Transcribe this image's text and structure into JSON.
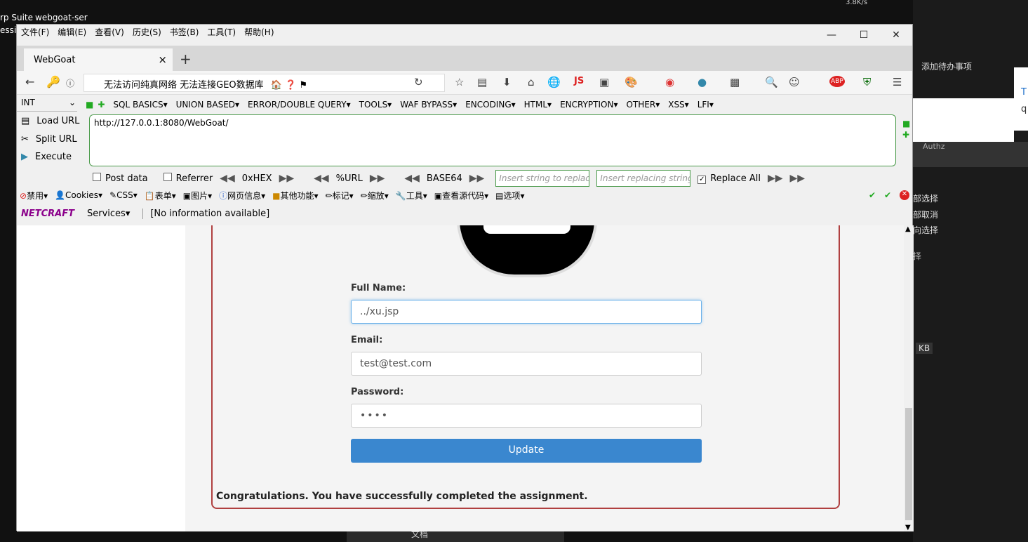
{
  "desktop": {
    "icon1_label": "rp Suite",
    "icon1_sub": "essi",
    "icon2_label": "webgoat-ser",
    "net_speed": "3.8K/s"
  },
  "right_panel": {
    "todo": "添加待办事项",
    "t_char": "T",
    "q_char": "q",
    "authz": "Authz",
    "select_all": "部选择",
    "cancel_all": "部取消",
    "invert": "向选择",
    "select": "择",
    "kb": "KB"
  },
  "menubar": [
    "文件(F)",
    "编辑(E)",
    "查看(V)",
    "历史(S)",
    "书签(B)",
    "工具(T)",
    "帮助(H)"
  ],
  "tab": {
    "title": "WebGoat",
    "close": "×",
    "new": "+"
  },
  "urlbar": {
    "text": "无法访问纯真网络   无法连接GEO数据库"
  },
  "icons": {
    "js": "JS",
    "abp": "ABP"
  },
  "hackbar": {
    "select": "INT",
    "menus": [
      "SQL BASICS▾",
      "UNION BASED▾",
      "ERROR/DOUBLE QUERY▾",
      "TOOLS▾",
      "WAF BYPASS▾",
      "ENCODING▾",
      "HTML▾",
      "ENCRYPTION▾",
      "OTHER▾",
      "XSS▾",
      "LFI▾"
    ],
    "load_url": "Load URL",
    "split_url": "Split URL",
    "execute": "Execute",
    "url_value": "http://127.0.0.1:8080/WebGoat/",
    "post_data": "Post data",
    "referrer": "Referrer",
    "hex": "0xHEX",
    "url_enc": "%URL",
    "base64": "BASE64",
    "insert_placeholder": "Insert string to replace",
    "replacing_placeholder": "Insert replacing string",
    "replace_all": "Replace All"
  },
  "toolbar2": [
    "禁用▾",
    "Cookies▾",
    "CSS▾",
    "表单▾",
    "图片▾",
    "网页信息▾",
    "其他功能▾",
    "标记▾",
    "缩放▾",
    "工具▾",
    "查看源代码▾",
    "选项▾"
  ],
  "toolbar3": {
    "netcraft": "NETCRAFT",
    "services": "Services▾",
    "info": "[No information available]"
  },
  "form": {
    "fullname_label": "Full Name:",
    "fullname_value": "../xu.jsp",
    "email_label": "Email:",
    "email_value": "test@test.com",
    "password_label": "Password:",
    "password_value": "••••",
    "update_button": "Update",
    "congrats": "Congratulations. You have successfully completed the assignment."
  },
  "taskbar": {
    "doc": "文档"
  }
}
